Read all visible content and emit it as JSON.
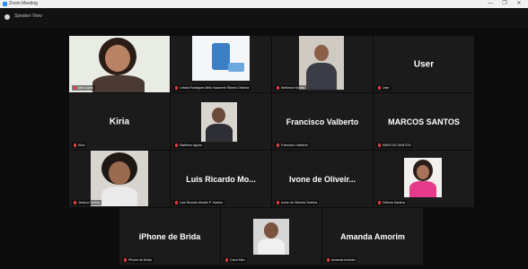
{
  "window": {
    "title": "Zoom Meeting",
    "controls": {
      "minimize": "—",
      "maximize": "❐",
      "close": "✕"
    }
  },
  "top": {
    "view_label": "Speaker View"
  },
  "participants": [
    {
      "caption": "Iara Lopes",
      "name_large": ""
    },
    {
      "caption": "Leticia Rodrigues Brito Nazareth Ribeiro Oliveira",
      "name_large": ""
    },
    {
      "caption": "Wellinton Moura",
      "name_large": ""
    },
    {
      "caption": "User",
      "name_large": "User"
    },
    {
      "caption": "Kiria",
      "name_large": "Kiria"
    },
    {
      "caption": "Matheus Aguiar",
      "name_large": ""
    },
    {
      "caption": "Francisco Valberto",
      "name_large": "Francisco Valberto"
    },
    {
      "caption": "MARCOS SANTOS",
      "name_large": "MARCOS SANTOS"
    },
    {
      "caption": "Jessica Santos",
      "name_large": ""
    },
    {
      "caption": "Luis Ricardo Morais P. Santos",
      "name_large": "Luis Ricardo Mo..."
    },
    {
      "caption": "Ivone de Oliveira Teixeira",
      "name_large": "Ivone de Oliveir..."
    },
    {
      "caption": "Débora Saraiva",
      "name_large": ""
    },
    {
      "caption": "iPhone de Brida",
      "name_large": "iPhone de Brida"
    },
    {
      "caption": "Carol Kiko",
      "name_large": ""
    },
    {
      "caption": "Amanda Amorim",
      "name_large": "Amanda Amorim"
    }
  ],
  "colors": {
    "background": "#0c0c0c",
    "tile": "#1b1b1b",
    "active_speaker_border": "#c7e24c",
    "muted_mic": "#e03b3b"
  }
}
